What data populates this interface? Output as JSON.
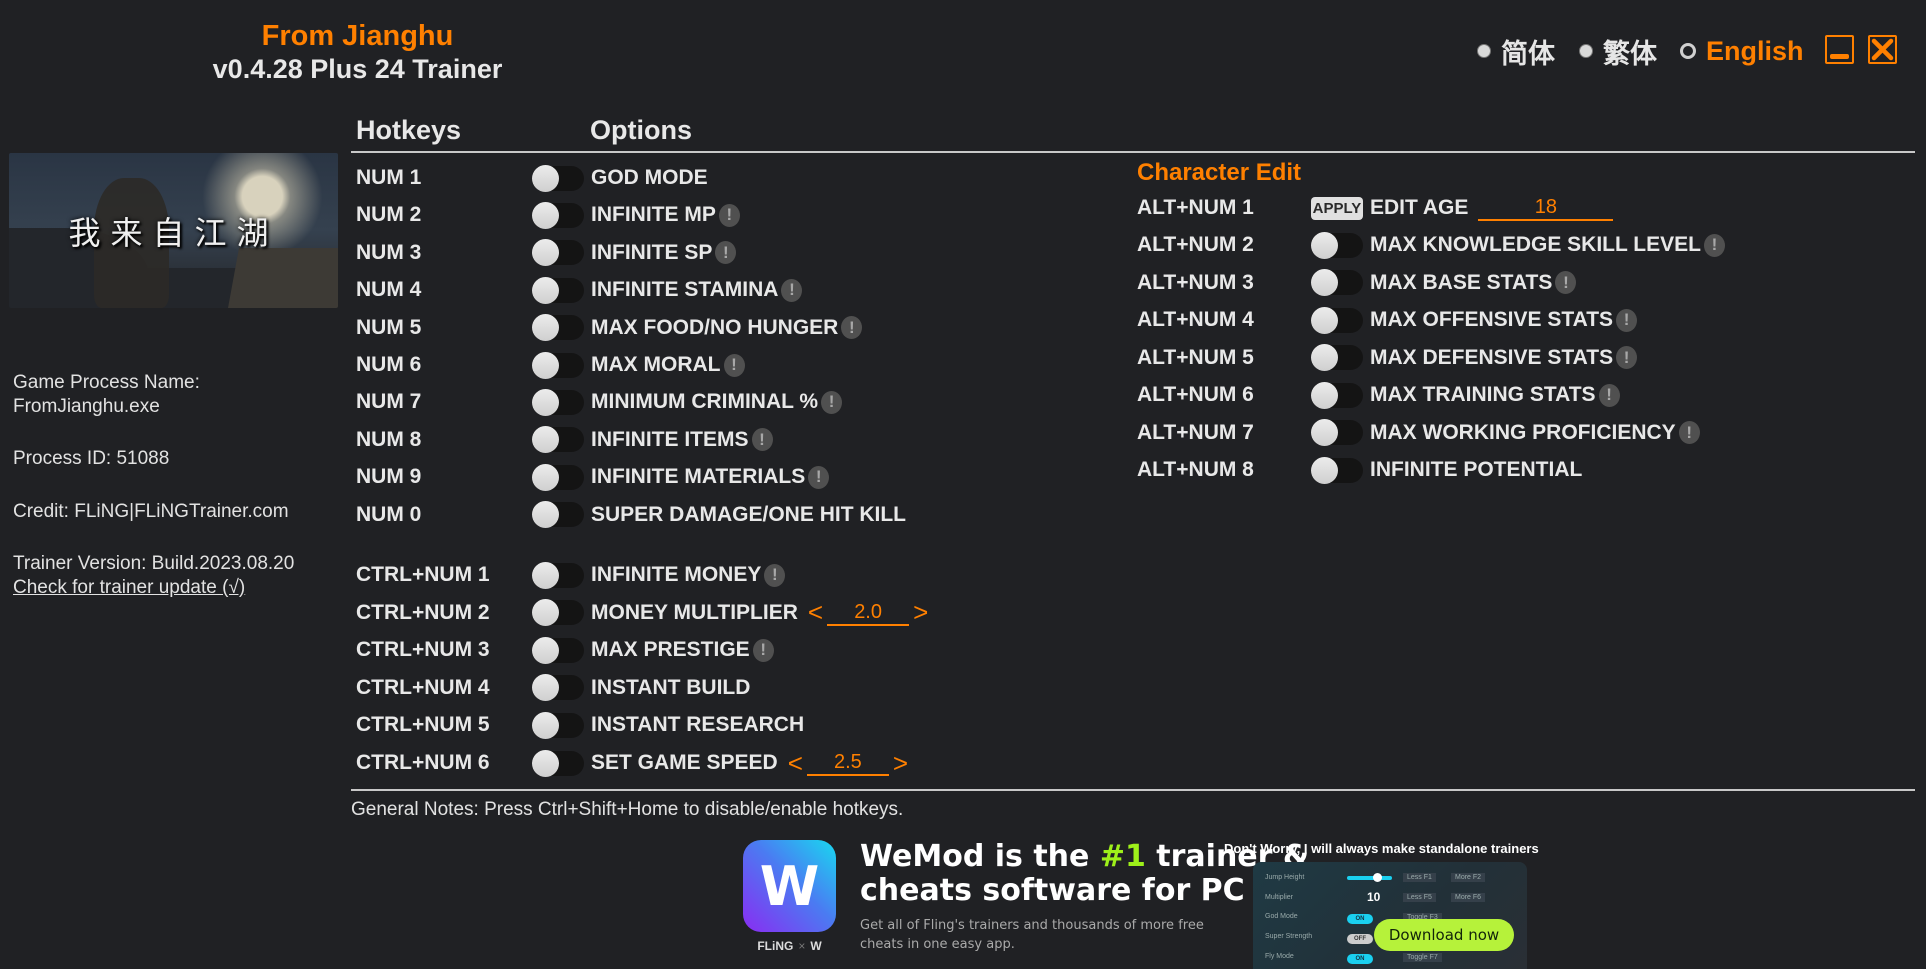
{
  "header": {
    "game_title": "From Jianghu",
    "trainer_title": "v0.4.28 Plus 24 Trainer"
  },
  "languages": [
    {
      "label": "简体",
      "selected": false
    },
    {
      "label": "繁体",
      "selected": false
    },
    {
      "label": "English",
      "selected": true
    }
  ],
  "window": {
    "minimize_icon": "minimize-icon",
    "close_icon": "close-icon",
    "accent": "#ff8000"
  },
  "banner": {
    "title": "我来自江湖"
  },
  "info": {
    "process_name_label": "Game Process Name:",
    "process_name": "FromJianghu.exe",
    "process_id": "Process ID: 51088",
    "credit": "Credit: FLiNG|FLiNGTrainer.com",
    "version": "Trainer Version: Build.2023.08.20",
    "update_link": "Check for trainer update (√)"
  },
  "columns": {
    "hotkeys": "Hotkeys",
    "options": "Options"
  },
  "left_options": [
    {
      "hotkey": "NUM 1",
      "label": "GOD MODE",
      "warn": false,
      "on": false
    },
    {
      "hotkey": "NUM 2",
      "label": "INFINITE MP",
      "warn": true,
      "on": false
    },
    {
      "hotkey": "NUM 3",
      "label": "INFINITE SP",
      "warn": true,
      "on": false
    },
    {
      "hotkey": "NUM 4",
      "label": "INFINITE STAMINA",
      "warn": true,
      "on": false
    },
    {
      "hotkey": "NUM 5",
      "label": "MAX FOOD/NO HUNGER",
      "warn": true,
      "on": false
    },
    {
      "hotkey": "NUM 6",
      "label": "MAX MORAL",
      "warn": true,
      "on": false
    },
    {
      "hotkey": "NUM 7",
      "label": "MINIMUM CRIMINAL %",
      "warn": true,
      "on": false
    },
    {
      "hotkey": "NUM 8",
      "label": "INFINITE ITEMS",
      "warn": true,
      "on": false
    },
    {
      "hotkey": "NUM 9",
      "label": "INFINITE MATERIALS",
      "warn": true,
      "on": false
    },
    {
      "hotkey": "NUM 0",
      "label": "SUPER DAMAGE/ONE HIT KILL",
      "warn": false,
      "on": false
    }
  ],
  "ctrl_options": [
    {
      "hotkey": "CTRL+NUM 1",
      "label": "INFINITE MONEY",
      "warn": true,
      "on": false
    },
    {
      "hotkey": "CTRL+NUM 2",
      "label": "MONEY MULTIPLIER",
      "warn": false,
      "on": false,
      "value": "2.0"
    },
    {
      "hotkey": "CTRL+NUM 3",
      "label": "MAX PRESTIGE",
      "warn": true,
      "on": false
    },
    {
      "hotkey": "CTRL+NUM 4",
      "label": "INSTANT BUILD",
      "warn": false,
      "on": false
    },
    {
      "hotkey": "CTRL+NUM 5",
      "label": "INSTANT RESEARCH",
      "warn": false,
      "on": false
    },
    {
      "hotkey": "CTRL+NUM 6",
      "label": "SET GAME SPEED",
      "warn": false,
      "on": false,
      "value": "2.5"
    }
  ],
  "spinner": {
    "left": "<",
    "right": ">"
  },
  "character_edit": {
    "title": "Character Edit",
    "apply_label": "APPLY",
    "edit_age": {
      "hotkey": "ALT+NUM 1",
      "label": "EDIT AGE",
      "value": "18"
    },
    "options": [
      {
        "hotkey": "ALT+NUM 2",
        "label": "MAX KNOWLEDGE SKILL LEVEL",
        "warn": true,
        "on": false
      },
      {
        "hotkey": "ALT+NUM 3",
        "label": "MAX BASE STATS",
        "warn": true,
        "on": false
      },
      {
        "hotkey": "ALT+NUM 4",
        "label": "MAX OFFENSIVE STATS",
        "warn": true,
        "on": false
      },
      {
        "hotkey": "ALT+NUM 5",
        "label": "MAX DEFENSIVE STATS",
        "warn": true,
        "on": false
      },
      {
        "hotkey": "ALT+NUM 6",
        "label": "MAX TRAINING STATS",
        "warn": true,
        "on": false
      },
      {
        "hotkey": "ALT+NUM 7",
        "label": "MAX WORKING PROFICIENCY",
        "warn": true,
        "on": false
      },
      {
        "hotkey": "ALT+NUM 8",
        "label": "INFINITE POTENTIAL",
        "warn": false,
        "on": false
      }
    ]
  },
  "warn_glyph": "!",
  "notes": "General Notes: Press Ctrl+Shift+Home to disable/enable hotkeys.",
  "ad": {
    "logo_glyph": "W",
    "brand_left": "FLiNG",
    "brand_x": "×",
    "brand_right": "W",
    "headline_1a": "WeMod is the ",
    "headline_1b": "#1",
    "headline_1c": " trainer &",
    "headline_2": "cheats software for PC games",
    "sub_1": "Get all of Fling's trainers and thousands of more free",
    "sub_2": "cheats in one easy app.",
    "note": "Don't Worry, I will always make standalone trainers",
    "download": "Download now",
    "preview": {
      "rows": [
        "Jump Height",
        "Multiplier",
        "God Mode",
        "Super Strength",
        "Fly Mode"
      ],
      "slider_value": "49",
      "stepper_value": "10",
      "toggles": [
        "ON",
        "OFF",
        "ON"
      ],
      "keys": [
        "Less F1",
        "More F2",
        "Less F5",
        "More F6",
        "Toggle F3",
        "Toggle F7"
      ]
    },
    "accent_green": "#9ef01a"
  }
}
